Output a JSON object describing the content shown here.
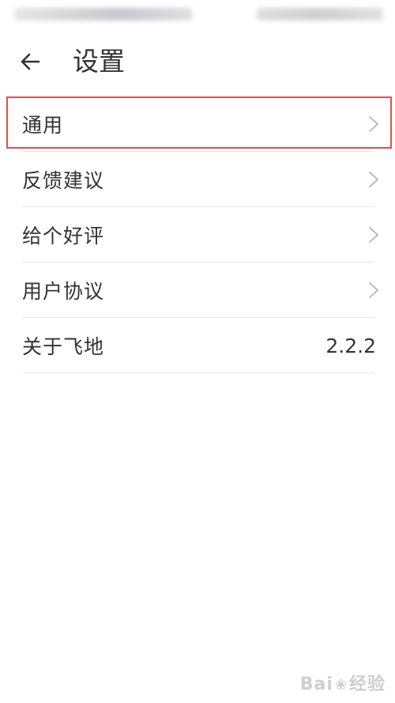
{
  "header": {
    "title": "设置"
  },
  "settings": {
    "items": [
      {
        "label": "通用",
        "has_chevron": true,
        "highlighted": true
      },
      {
        "label": "反馈建议",
        "has_chevron": true
      },
      {
        "label": "给个好评",
        "has_chevron": true
      },
      {
        "label": "用户协议",
        "has_chevron": true
      },
      {
        "label": "关于飞地",
        "value": "2.2.2"
      }
    ]
  },
  "watermark": {
    "text_left": "Bai",
    "text_right": "经验"
  },
  "colors": {
    "highlight_border": "#d9534f",
    "divider": "#e6e6e6",
    "text": "#333333",
    "chevron": "#bbbbbb"
  },
  "icons": {
    "back": "arrow-left-icon",
    "chevron": "chevron-right-icon"
  }
}
